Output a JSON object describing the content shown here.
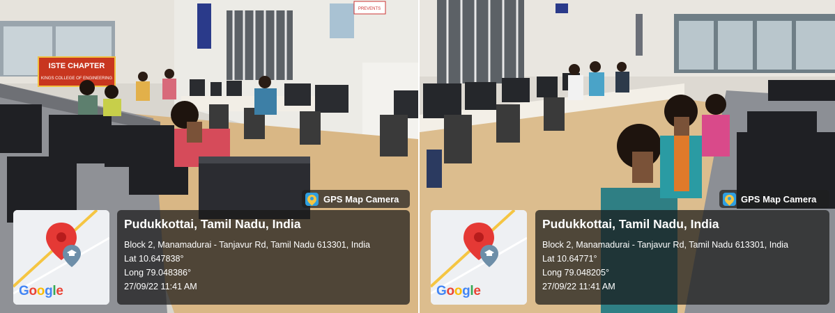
{
  "photos": [
    {
      "watermark_label": "GPS Map Camera",
      "location_title": "Pudukkottai, Tamil Nadu, India",
      "address": "Block 2, Manamadurai - Tanjavur Rd, Tamil Nadu 613301, India",
      "lat": "Lat 10.647838°",
      "long": "Long 79.048386°",
      "datetime": "27/09/22 11:41 AM",
      "banner_text": "ISTE CHAPTER",
      "banner_subtext": "KINGS COLLEGE OF ENGINEERING",
      "sign_text": "PREVENTS"
    },
    {
      "watermark_label": "GPS Map Camera",
      "location_title": "Pudukkottai, Tamil Nadu, India",
      "address": "Block 2, Manamadurai - Tanjavur Rd, Tamil Nadu 613301, India",
      "lat": "Lat 10.64771°",
      "long": "Long 79.048205°",
      "datetime": "27/09/22 11:41 AM"
    }
  ],
  "map_logo": [
    "G",
    "o",
    "o",
    "g",
    "l",
    "e"
  ],
  "icons": {
    "watermark": "gps-map-camera-icon",
    "pin": "map-pin-icon",
    "place": "graduation-cap-icon"
  },
  "colors": {
    "pin": "#e53935",
    "panel": "#191919",
    "map_road": "#f5c542"
  }
}
